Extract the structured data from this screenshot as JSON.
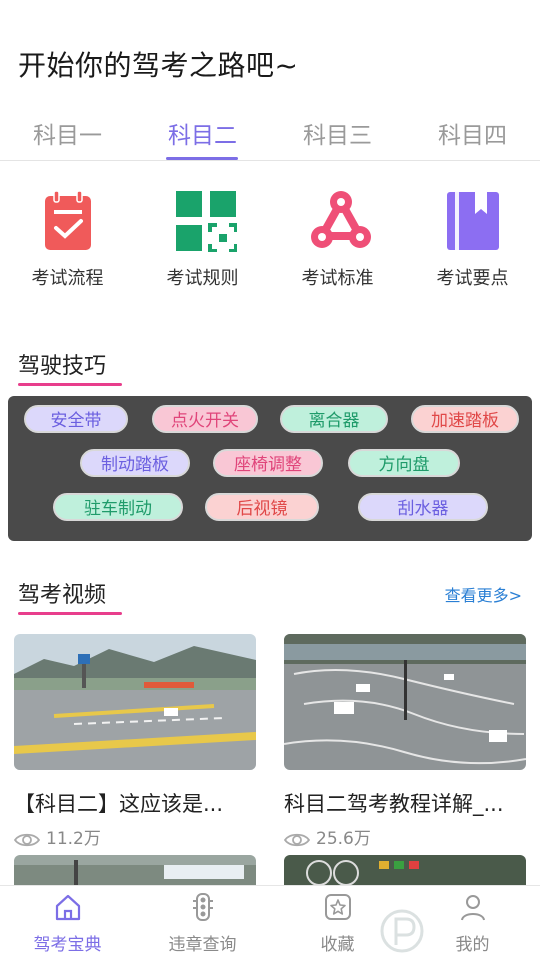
{
  "header": {
    "title": "开始你的驾考之路吧~"
  },
  "tabs": [
    {
      "label": "科目一"
    },
    {
      "label": "科目二"
    },
    {
      "label": "科目三"
    },
    {
      "label": "科目四"
    }
  ],
  "categories": [
    {
      "label": "考试流程",
      "icon": "exam-process-icon",
      "color": "#f05a5a"
    },
    {
      "label": "考试规则",
      "icon": "exam-rules-icon",
      "color": "#1aa36b"
    },
    {
      "label": "考试标准",
      "icon": "exam-standard-icon",
      "color": "#ef4f77"
    },
    {
      "label": "考试要点",
      "icon": "exam-keypoints-icon",
      "color": "#8c6ef2"
    }
  ],
  "tips": {
    "title": "驾驶技巧",
    "chips": [
      {
        "label": "安全带",
        "bg": "#dcd8fb",
        "color": "#6b5fe0"
      },
      {
        "label": "点火开关",
        "bg": "#f9c7d5",
        "color": "#e0457a"
      },
      {
        "label": "离合器",
        "bg": "#bff0dc",
        "color": "#1f9b6a"
      },
      {
        "label": "加速踏板",
        "bg": "#fbd2d2",
        "color": "#e04848"
      },
      {
        "label": "制动踏板",
        "bg": "#dcd8fb",
        "color": "#6b5fe0"
      },
      {
        "label": "座椅调整",
        "bg": "#f9c7d5",
        "color": "#e0457a"
      },
      {
        "label": "方向盘",
        "bg": "#bff0dc",
        "color": "#1f9b6a"
      },
      {
        "label": "驻车制动",
        "bg": "#bff0dc",
        "color": "#1f9b6a"
      },
      {
        "label": "后视镜",
        "bg": "#fbd2d2",
        "color": "#e04848"
      },
      {
        "label": "刮水器",
        "bg": "#dcd8fb",
        "color": "#6b5fe0"
      }
    ]
  },
  "videos": {
    "title": "驾考视频",
    "more_label": "查看更多>",
    "items": [
      {
        "title": "【科目二】这应该是...",
        "views": "11.2万"
      },
      {
        "title": "科目二驾考教程详解_...",
        "views": "25.6万"
      }
    ]
  },
  "bottom_nav": [
    {
      "label": "驾考宝典",
      "icon": "home-icon"
    },
    {
      "label": "违章查询",
      "icon": "traffic-light-icon"
    },
    {
      "label": "收藏",
      "icon": "favorite-star-icon"
    },
    {
      "label": "我的",
      "icon": "profile-icon"
    }
  ],
  "colors": {
    "accent": "#7c6ee6",
    "underline": "#e83e8c",
    "link": "#2a7fd4"
  }
}
